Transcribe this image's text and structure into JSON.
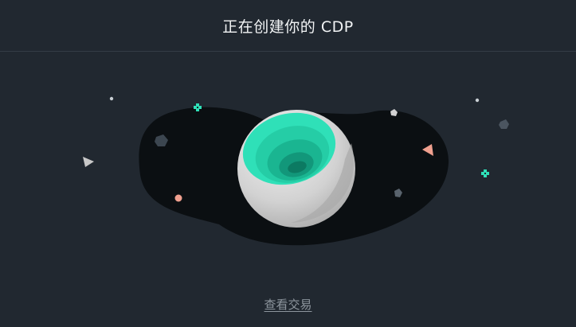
{
  "header": {
    "title": "正在创建你的 CDP"
  },
  "illustration": {
    "name": "planet-portal-illustration"
  },
  "footer": {
    "view_transaction_label": "查看交易"
  },
  "colors": {
    "background": "#212830",
    "blob": "#0b0f12",
    "accent": "#2fe0b8",
    "coral": "#f0a08f"
  }
}
